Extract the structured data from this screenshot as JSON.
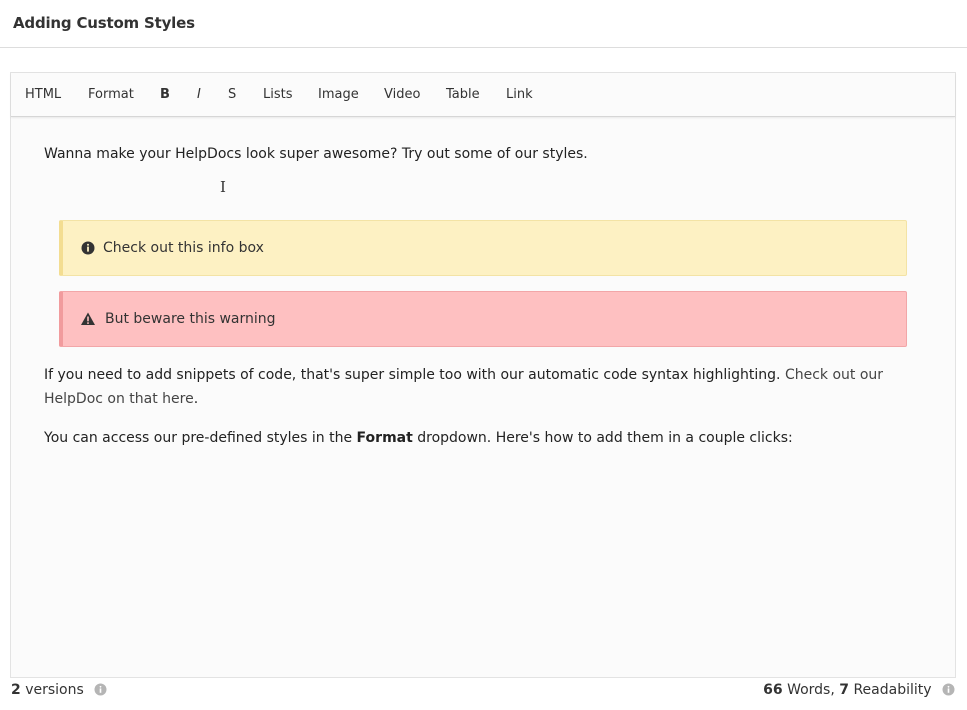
{
  "page": {
    "title": "Adding Custom Styles"
  },
  "toolbar": {
    "items": [
      {
        "label": "HTML"
      },
      {
        "label": "Format"
      },
      {
        "label": "B"
      },
      {
        "label": "I"
      },
      {
        "label": "S"
      },
      {
        "label": "Lists"
      },
      {
        "label": "Image"
      },
      {
        "label": "Video"
      },
      {
        "label": "Table"
      },
      {
        "label": "Link"
      }
    ]
  },
  "content": {
    "intro": "Wanna make your HelpDocs look super awesome? Try out some of our styles.",
    "info_box": {
      "icon": "info-circle-icon",
      "text": "Check out this info box",
      "color": "#fdf1c3"
    },
    "warning_box": {
      "icon": "warning-triangle-icon",
      "text": "But beware this warning",
      "color": "#fec0c1"
    },
    "code_para": {
      "text": "If you need to add snippets of code, that's super simple too with our automatic code syntax highlighting.",
      "link": "Check out our HelpDoc on that here",
      "suffix": "."
    },
    "format_para": {
      "prefix": "You can access our pre-defined styles in the ",
      "bold": "Format",
      "suffix": " dropdown. Here's how to add them in a couple clicks:"
    }
  },
  "footer": {
    "versions_count": "2",
    "versions_label": "versions",
    "words_count": "66",
    "words_label": "Words,",
    "readability_count": "7",
    "readability_label": "Readability"
  }
}
